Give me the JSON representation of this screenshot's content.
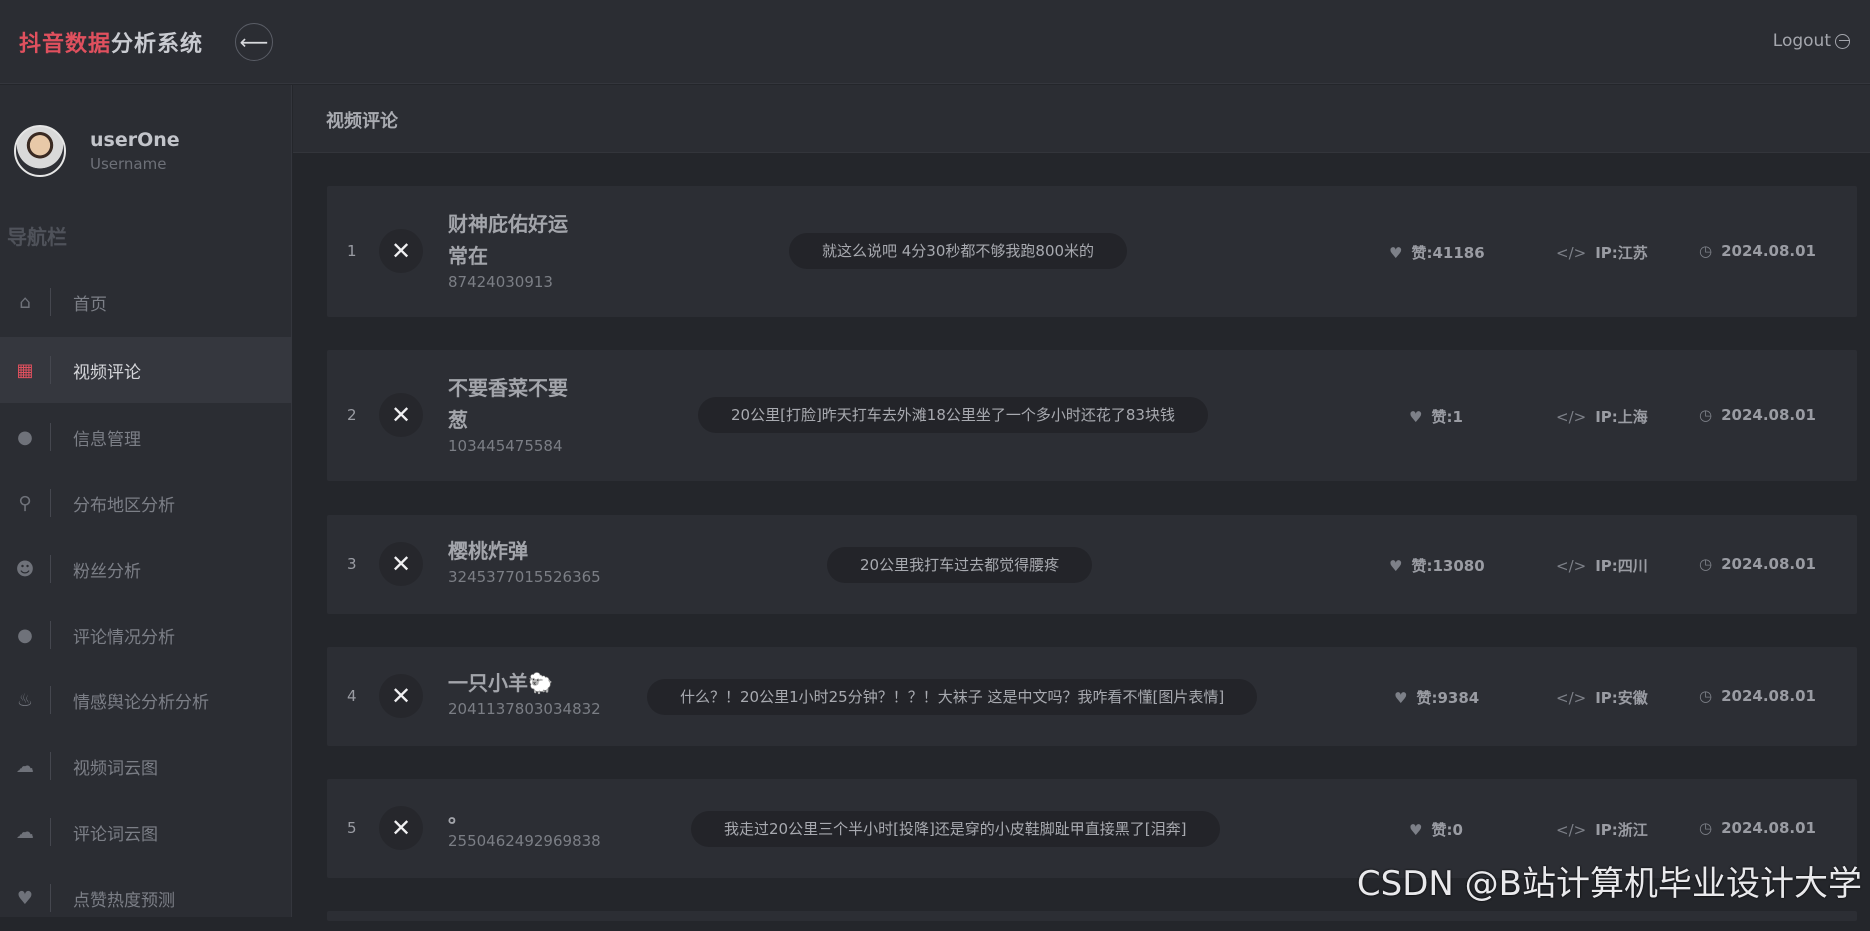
{
  "header": {
    "brand_accent": "抖音数据",
    "brand_rest": "分析系统",
    "back_icon": "arrow-left-icon",
    "logout_label": "Logout"
  },
  "sidebar": {
    "user": {
      "name": "userOne",
      "role": "Username"
    },
    "nav_title": "导航栏",
    "items": [
      {
        "label": "首页",
        "icon": "home-icon"
      },
      {
        "label": "视频评论",
        "icon": "grid-icon",
        "active": true
      },
      {
        "label": "信息管理",
        "icon": "user-icon"
      },
      {
        "label": "分布地区分析",
        "icon": "map-pin-icon"
      },
      {
        "label": "粉丝分析",
        "icon": "users-icon"
      },
      {
        "label": "评论情况分析",
        "icon": "comment-icon"
      },
      {
        "label": "情感舆论分析分析",
        "icon": "fire-icon"
      },
      {
        "label": "视频词云图",
        "icon": "cloud-icon"
      },
      {
        "label": "评论词云图",
        "icon": "cloud-icon"
      },
      {
        "label": "点赞热度预测",
        "icon": "heart-icon"
      }
    ]
  },
  "main": {
    "title": "视频评论",
    "rows": [
      {
        "index": "1",
        "nick": "财神庇佑好运常在",
        "uid": "87424030913",
        "comment": "就这么说吧 4分30秒都不够我跑800米的",
        "likes": "赞:41186",
        "ip": "IP:江苏",
        "date": "2024.08.01"
      },
      {
        "index": "2",
        "nick": "不要香菜不要葱",
        "uid": "103445475584",
        "comment": "20公里[打脸]昨天打车去外滩18公里坐了一个多小时还花了83块钱",
        "likes": "赞:1",
        "ip": "IP:上海",
        "date": "2024.08.01"
      },
      {
        "index": "3",
        "nick": "樱桃炸弹",
        "uid": "3245377015526365",
        "comment": "20公里我打车过去都觉得腰疼",
        "likes": "赞:13080",
        "ip": "IP:四川",
        "date": "2024.08.01"
      },
      {
        "index": "4",
        "nick": "一只小羊🐑",
        "uid": "2041137803034832",
        "comment": "什么？！20公里1小时25分钟？！？！大袜子 这是中文吗？我咋看不懂[图片表情]",
        "likes": "赞:9384",
        "ip": "IP:安徽",
        "date": "2024.08.01"
      },
      {
        "index": "5",
        "nick": "。",
        "uid": "2550462492969838",
        "comment": "我走过20公里三个半小时[投降]还是穿的小皮鞋脚趾甲直接黑了[泪奔]",
        "likes": "赞:0",
        "ip": "IP:浙江",
        "date": "2024.08.01"
      }
    ]
  },
  "watermark": "CSDN @B站计算机毕业设计大学"
}
